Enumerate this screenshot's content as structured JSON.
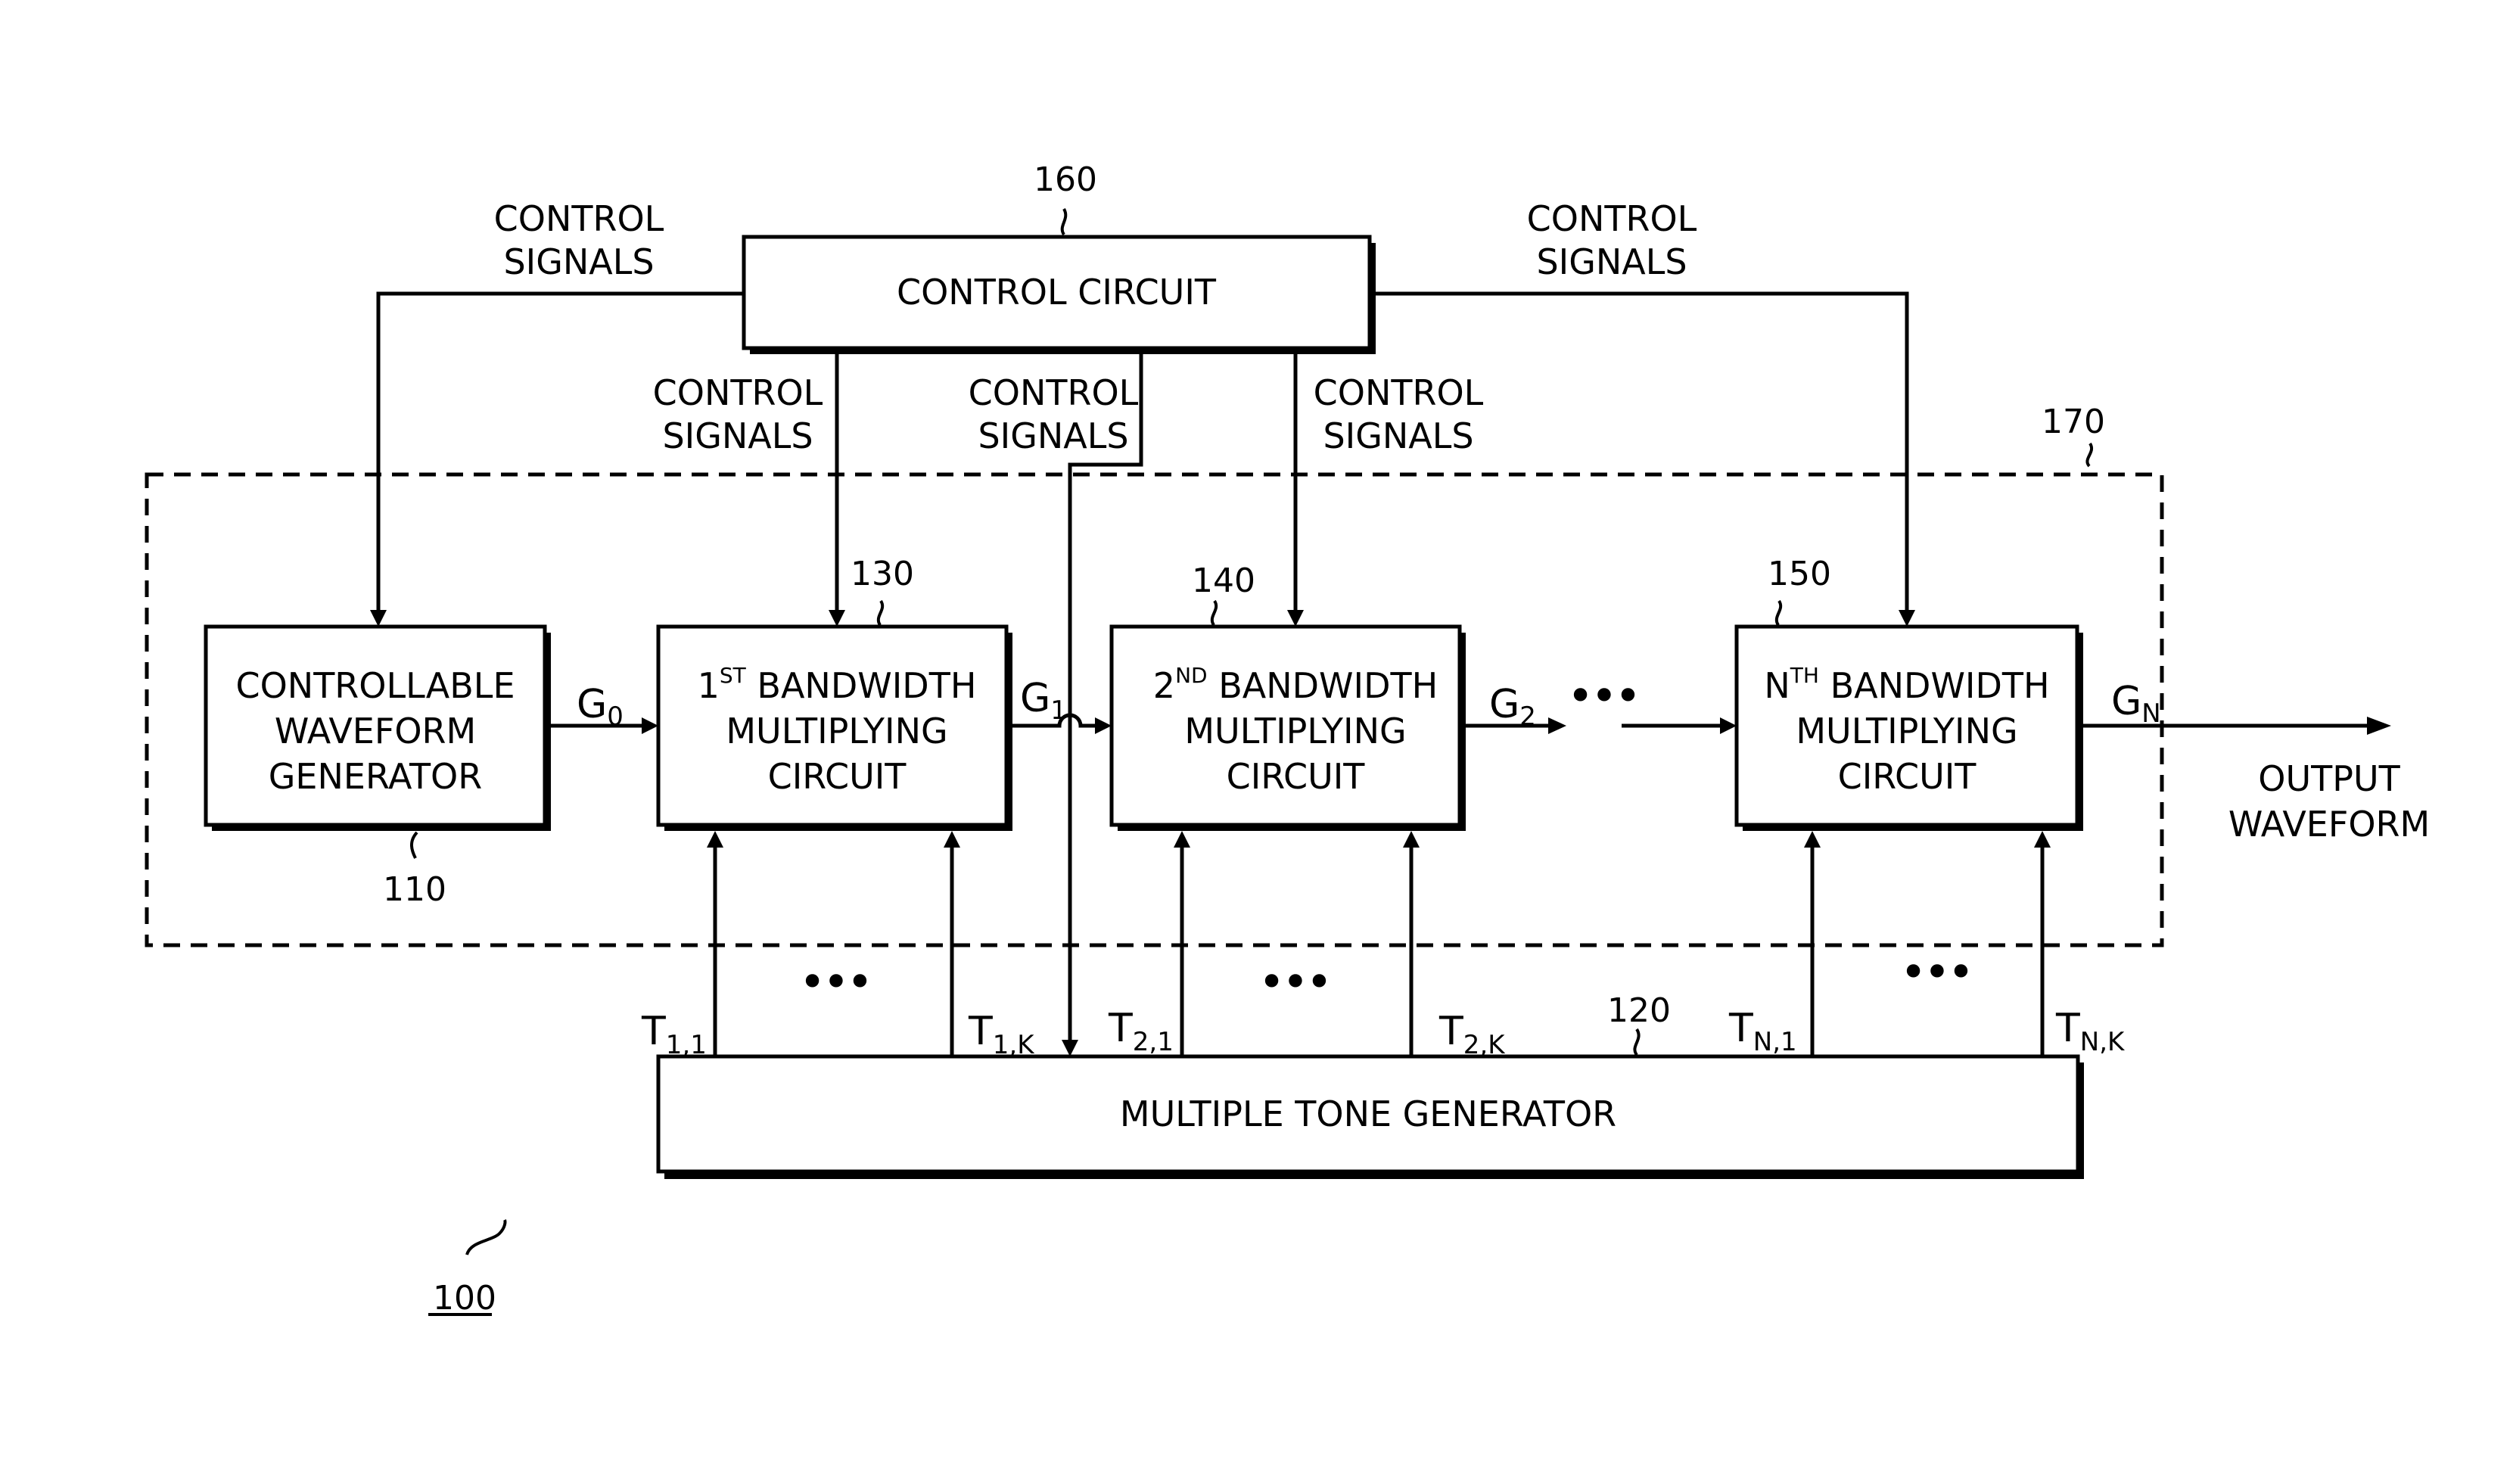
{
  "figure": {
    "reference": "100",
    "control_circuit": {
      "label": "CONTROL CIRCUIT",
      "ref": "160"
    },
    "control_signal_label": [
      "CONTROL",
      "SIGNALS"
    ],
    "enclosure": {
      "ref": "170"
    },
    "waveform_generator": {
      "lines": [
        "CONTROLLABLE",
        "WAVEFORM",
        "GENERATOR"
      ],
      "ref": "110"
    },
    "bw_circuits": [
      {
        "ordinal": "1",
        "suffix": "ST",
        "lines": [
          "BANDWIDTH",
          "MULTIPLYING",
          "CIRCUIT"
        ],
        "ref": "130"
      },
      {
        "ordinal": "2",
        "suffix": "ND",
        "lines": [
          "BANDWIDTH",
          "MULTIPLYING",
          "CIRCUIT"
        ],
        "ref": "140"
      },
      {
        "ordinal": "N",
        "suffix": "TH",
        "lines": [
          "BANDWIDTH",
          "MULTIPLYING",
          "CIRCUIT"
        ],
        "ref": "150"
      }
    ],
    "tone_generator": {
      "label": "MULTIPLE TONE GENERATOR",
      "ref": "120"
    },
    "signals": [
      {
        "base": "G",
        "sub": "0"
      },
      {
        "base": "G",
        "sub": "1"
      },
      {
        "base": "G",
        "sub": "2"
      },
      {
        "base": "G",
        "sub": "N"
      }
    ],
    "tones": [
      {
        "base": "T",
        "sub": "1,1"
      },
      {
        "base": "T",
        "sub": "1,K"
      },
      {
        "base": "T",
        "sub": "2,1"
      },
      {
        "base": "T",
        "sub": "2,K"
      },
      {
        "base": "T",
        "sub": "N,1"
      },
      {
        "base": "T",
        "sub": "N,K"
      }
    ],
    "output_label": [
      "OUTPUT",
      "WAVEFORM"
    ],
    "ellipsis": "•••"
  }
}
